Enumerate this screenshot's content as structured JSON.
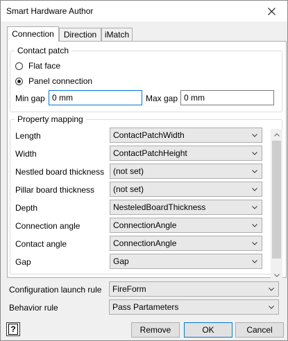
{
  "window": {
    "title": "Smart Hardware Author"
  },
  "tabs": [
    {
      "label": "Connection",
      "active": true
    },
    {
      "label": "Direction",
      "active": false
    },
    {
      "label": "iMatch",
      "active": false
    }
  ],
  "contact_patch": {
    "legend": "Contact patch",
    "options": [
      {
        "label": "Flat face",
        "checked": false
      },
      {
        "label": "Panel connection",
        "checked": true
      }
    ],
    "min_gap_label": "Min gap",
    "min_gap_value": "0 mm",
    "max_gap_label": "Max gap",
    "max_gap_value": "0 mm"
  },
  "property_mapping": {
    "legend": "Property mapping",
    "rows": [
      {
        "label": "Length",
        "value": "ContactPatchWidth"
      },
      {
        "label": "Width",
        "value": "ContactPatchHeight"
      },
      {
        "label": "Nestled board thickness",
        "value": "(not set)"
      },
      {
        "label": "Pillar board thickness",
        "value": "(not set)"
      },
      {
        "label": "Depth",
        "value": "NesteledBoardThickness"
      },
      {
        "label": "Connection angle",
        "value": "ConnectionAngle"
      },
      {
        "label": "Contact angle",
        "value": "ConnectionAngle"
      },
      {
        "label": "Gap",
        "value": "Gap"
      }
    ]
  },
  "configuration_launch_rule": {
    "label": "Configuration launch rule",
    "value": "FireForm"
  },
  "behavior_rule": {
    "label": "Behavior rule",
    "value": "Pass Partameters"
  },
  "buttons": {
    "help": "?",
    "remove": "Remove",
    "ok": "OK",
    "cancel": "Cancel"
  },
  "icons": {
    "close": "close-icon",
    "dropdown": "chevron-down-icon",
    "scroll_up": "scroll-up-icon",
    "scroll_down": "scroll-down-icon",
    "help": "help-icon"
  },
  "colors": {
    "focus_border": "#0078d7",
    "panel_bg": "#f0f0f0"
  }
}
